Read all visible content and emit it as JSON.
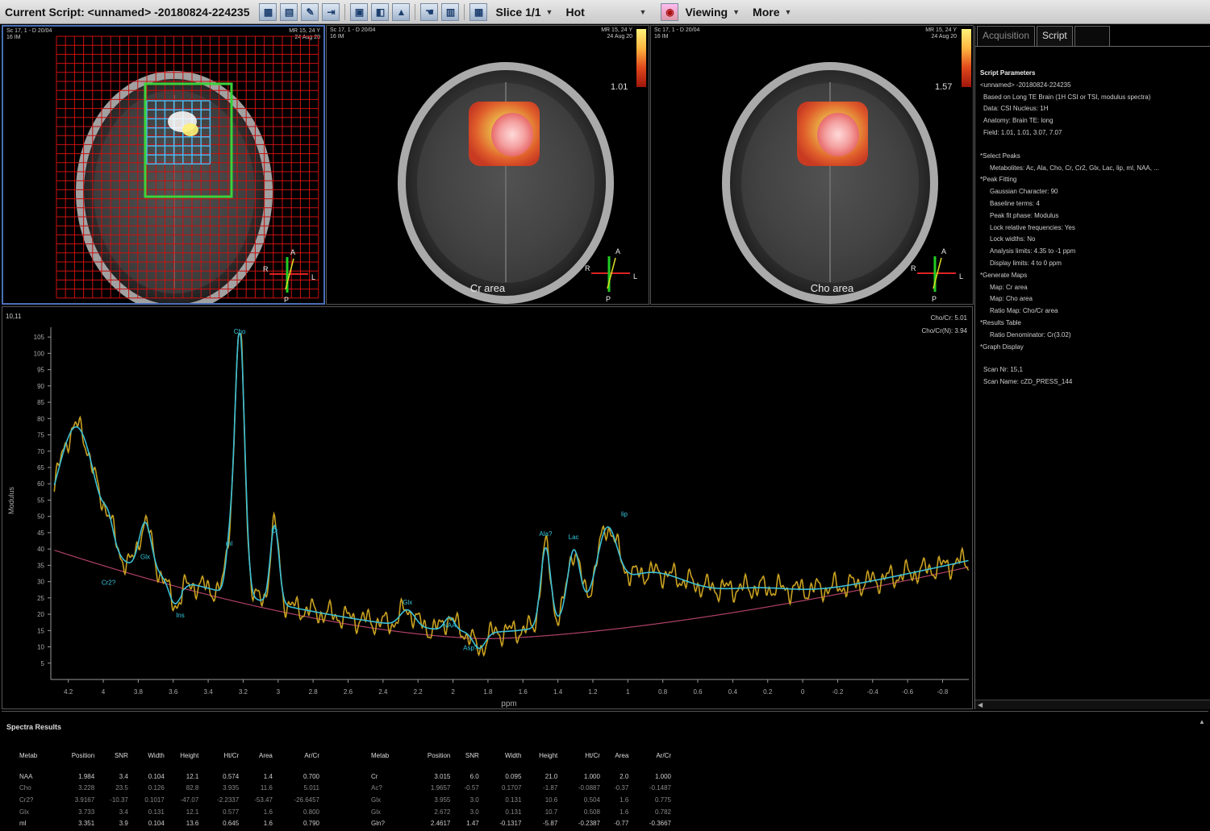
{
  "toolbar": {
    "title": "Current Script: <unnamed> -20180824-224235",
    "slice_label": "Slice 1/1",
    "colormap_label": "Hot",
    "viewing_label": "Viewing",
    "more_label": "More"
  },
  "views": [
    {
      "tl": [
        "Sc 17, 1 - D 20/04",
        "16  IM"
      ],
      "tr": [
        "MR 15, 24 Y",
        "24 Aug 20"
      ],
      "caption": "",
      "colorbar_value": ""
    },
    {
      "tl": [
        "Sc 17, 1 - D 20/04",
        "16  IM"
      ],
      "tr": [
        "MR 15, 24 Y",
        "24 Aug 20"
      ],
      "caption": "Cr area",
      "colorbar_value": "1.01"
    },
    {
      "tl": [
        "Sc 17, 1 - D 20/04",
        "16  IM"
      ],
      "tr": [
        "MR 15, 24 Y",
        "24 Aug 20"
      ],
      "caption": "Cho area",
      "colorbar_value": "1.57"
    }
  ],
  "orientation": {
    "a": "A",
    "p": "P",
    "r": "R",
    "l": "L"
  },
  "spectrum": {
    "voxel_label": "10,11",
    "ratio1": "Cho/Cr: 5.01",
    "ratio2": "Cho/Cr(N): 3.94",
    "ylabel": "Modulus",
    "xlabel": "ppm",
    "y_ticks": [
      5,
      10,
      15,
      20,
      25,
      30,
      35,
      40,
      45,
      50,
      55,
      60,
      65,
      70,
      75,
      80,
      85,
      90,
      95,
      100,
      105
    ],
    "x_ticks": [
      "4.2",
      "4",
      "3.8",
      "3.6",
      "3.4",
      "3.2",
      "3",
      "2.8",
      "2.6",
      "2.4",
      "2.2",
      "2",
      "1.8",
      "1.6",
      "1.4",
      "1.2",
      "1",
      "0.8",
      "0.6",
      "0.4",
      "0.2",
      "0",
      "-0.2",
      "-0.4",
      "-0.6",
      "-0.8"
    ],
    "peak_labels": [
      {
        "text": "Cho",
        "ppm": 3.22,
        "y": 105
      },
      {
        "text": "Cr",
        "ppm": 3.02,
        "y": 44
      },
      {
        "text": "Glx",
        "ppm": 3.76,
        "y": 36
      },
      {
        "text": "Cr2?",
        "ppm": 3.97,
        "y": 28
      },
      {
        "text": "Ins",
        "ppm": 3.56,
        "y": 18
      },
      {
        "text": "ml",
        "ppm": 3.28,
        "y": 40
      },
      {
        "text": "Glx",
        "ppm": 2.26,
        "y": 22
      },
      {
        "text": "NAA",
        "ppm": 2.02,
        "y": 15
      },
      {
        "text": "Asp?",
        "ppm": 1.9,
        "y": 8
      },
      {
        "text": "Ala?",
        "ppm": 1.47,
        "y": 43
      },
      {
        "text": "Lac",
        "ppm": 1.31,
        "y": 42
      },
      {
        "text": "lip",
        "ppm": 1.02,
        "y": 49
      }
    ],
    "colors": {
      "data": "#c8a020",
      "fit": "#3bbfd6",
      "baseline": "#b0406a",
      "label": "#35c8e0"
    }
  },
  "right_panel": {
    "tabs": [
      "Acquisition",
      "Script",
      ""
    ],
    "heading": "Script Parameters",
    "lines": [
      {
        "t": "<unnamed> -20180824-224235",
        "l": 1
      },
      {
        "t": "Based on Long TE Brain (1H CSI or TSI, modulus spectra)",
        "l": 2
      },
      {
        "t": "Data: CSI   Nucleus: 1H",
        "l": 2
      },
      {
        "t": "Anatomy: Brain   TE: long",
        "l": 2
      },
      {
        "t": "Field: 1.01, 1.01, 3.07, 7.07",
        "l": 2
      },
      {
        "t": "",
        "l": 0
      },
      {
        "t": "*Select Peaks",
        "l": 1
      },
      {
        "t": "Metabolites: Ac, Ala, Cho, Cr, Cr2, Glx, Lac, lip, ml, NAA, ...",
        "l": 3
      },
      {
        "t": "*Peak Fitting",
        "l": 1
      },
      {
        "t": "Gaussian Character: 90",
        "l": 3
      },
      {
        "t": "Baseline terms: 4",
        "l": 3
      },
      {
        "t": "Peak fit phase: Modulus",
        "l": 3
      },
      {
        "t": "Lock relative frequencies: Yes",
        "l": 3
      },
      {
        "t": "Lock widths: No",
        "l": 3
      },
      {
        "t": "Analysis limits: 4.35 to -1 ppm",
        "l": 3
      },
      {
        "t": "Display limits: 4 to 0 ppm",
        "l": 3
      },
      {
        "t": "*Generate Maps",
        "l": 1
      },
      {
        "t": "Map: Cr area",
        "l": 3
      },
      {
        "t": "Map: Cho area",
        "l": 3
      },
      {
        "t": "Ratio Map: Cho/Cr area",
        "l": 3
      },
      {
        "t": "*Results Table",
        "l": 1
      },
      {
        "t": "Ratio Denominator: Cr(3.02)",
        "l": 3
      },
      {
        "t": "*Graph Display",
        "l": 1
      },
      {
        "t": "",
        "l": 0
      },
      {
        "t": "Scan Nr: 15,1",
        "l": 2
      },
      {
        "t": "Scan Name: cZD_PRESS_144",
        "l": 2
      }
    ]
  },
  "results": {
    "heading": "Spectra Results",
    "columns": [
      "Metab",
      "Position",
      "SNR",
      "Width",
      "Height",
      "Ht/Cr",
      "Area",
      "Ar/Cr"
    ],
    "left_rows": [
      [
        "NAA",
        "1.984",
        "3.4",
        "0.104",
        "12.1",
        "0.574",
        "1.4",
        "0.700"
      ],
      [
        "Cho",
        "3.228",
        "23.5",
        "0.126",
        "82.8",
        "3.935",
        "11.6",
        "5.011"
      ],
      [
        "Cr2?",
        "3.9167",
        "-10.37",
        "0.1017",
        "-47.07",
        "-2.2337",
        "-53.47",
        "-26.6457"
      ],
      [
        "Glx",
        "3.733",
        "3.4",
        "0.131",
        "12.1",
        "0.577",
        "1.6",
        "0.800"
      ],
      [
        "ml",
        "3.351",
        "3.9",
        "0.104",
        "13.6",
        "0.645",
        "1.6",
        "0.790"
      ]
    ],
    "right_rows": [
      [
        "Cr",
        "3.015",
        "6.0",
        "0.095",
        "21.0",
        "1.000",
        "2.0",
        "1.000"
      ],
      [
        "Ac?",
        "1.9657",
        "-0.57",
        "0.1707",
        "-1.87",
        "-0.0887",
        "-0.37",
        "-0.1487"
      ],
      [
        "Glx",
        "3.955",
        "3.0",
        "0.131",
        "10.6",
        "0.504",
        "1.6",
        "0.775"
      ],
      [
        "Glx",
        "2.672",
        "3.0",
        "0.131",
        "10.7",
        "0.508",
        "1.6",
        "0.782"
      ],
      [
        "Gln?",
        "2.4617",
        "1.47",
        "-0.1317",
        "-5.87",
        "-0.2387",
        "-0.77",
        "-0.3667"
      ]
    ],
    "dim_rows": [
      1,
      2,
      3
    ]
  }
}
